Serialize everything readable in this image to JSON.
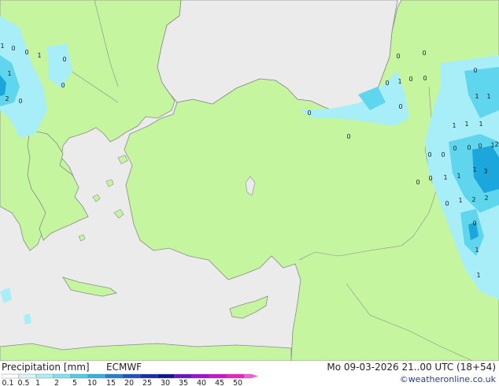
{
  "map": {
    "colors": {
      "sea": "#ebebeb",
      "land": "#c6f5a0",
      "border": "#8a8a8a",
      "precip_light": "#a8eef8",
      "precip_mid": "#5fd6ee",
      "precip_heavy": "#1ba7db",
      "label_text": "#222222"
    },
    "point_values": [
      {
        "text": "1"
      },
      {
        "text": "0"
      },
      {
        "text": "0"
      },
      {
        "text": "1"
      },
      {
        "text": "0"
      },
      {
        "text": "1"
      },
      {
        "text": "0"
      },
      {
        "text": "2"
      },
      {
        "text": "0"
      },
      {
        "text": "0"
      },
      {
        "text": "0"
      },
      {
        "text": "0"
      },
      {
        "text": "0"
      },
      {
        "text": "1"
      },
      {
        "text": "0"
      },
      {
        "text": "0"
      },
      {
        "text": "0"
      },
      {
        "text": "0"
      },
      {
        "text": "0"
      },
      {
        "text": "1"
      },
      {
        "text": "1"
      },
      {
        "text": "1"
      },
      {
        "text": "1"
      },
      {
        "text": "1"
      },
      {
        "text": "0"
      },
      {
        "text": "0"
      },
      {
        "text": "0"
      },
      {
        "text": "1"
      },
      {
        "text": "2"
      },
      {
        "text": "0"
      },
      {
        "text": "0"
      },
      {
        "text": "1"
      },
      {
        "text": "3"
      },
      {
        "text": "0"
      },
      {
        "text": "1"
      },
      {
        "text": "1"
      },
      {
        "text": "0"
      },
      {
        "text": "1"
      },
      {
        "text": "2"
      },
      {
        "text": "2"
      },
      {
        "text": "0"
      },
      {
        "text": "0"
      },
      {
        "text": "1"
      },
      {
        "text": "1"
      }
    ]
  },
  "footer": {
    "title": "Precipitation [mm]",
    "model": "ECMWF",
    "datetime": "Mo 09-03-2026 21..00 UTC (18+54)",
    "credit": "©weatheronline.co.uk"
  },
  "legend": {
    "labels": [
      "0.1",
      "0.5",
      "1",
      "2",
      "5",
      "10",
      "15",
      "20",
      "25",
      "30",
      "35",
      "40",
      "45",
      "50"
    ],
    "colors": [
      "#ffffff",
      "#d4f7fb",
      "#a8eef8",
      "#7fe2f4",
      "#4fcdee",
      "#2fb1e4",
      "#2080d0",
      "#1a55c0",
      "#1430a8",
      "#0c1890",
      "#7010c8",
      "#a010d0",
      "#d010d0",
      "#f020c8",
      "#f060e0"
    ]
  }
}
